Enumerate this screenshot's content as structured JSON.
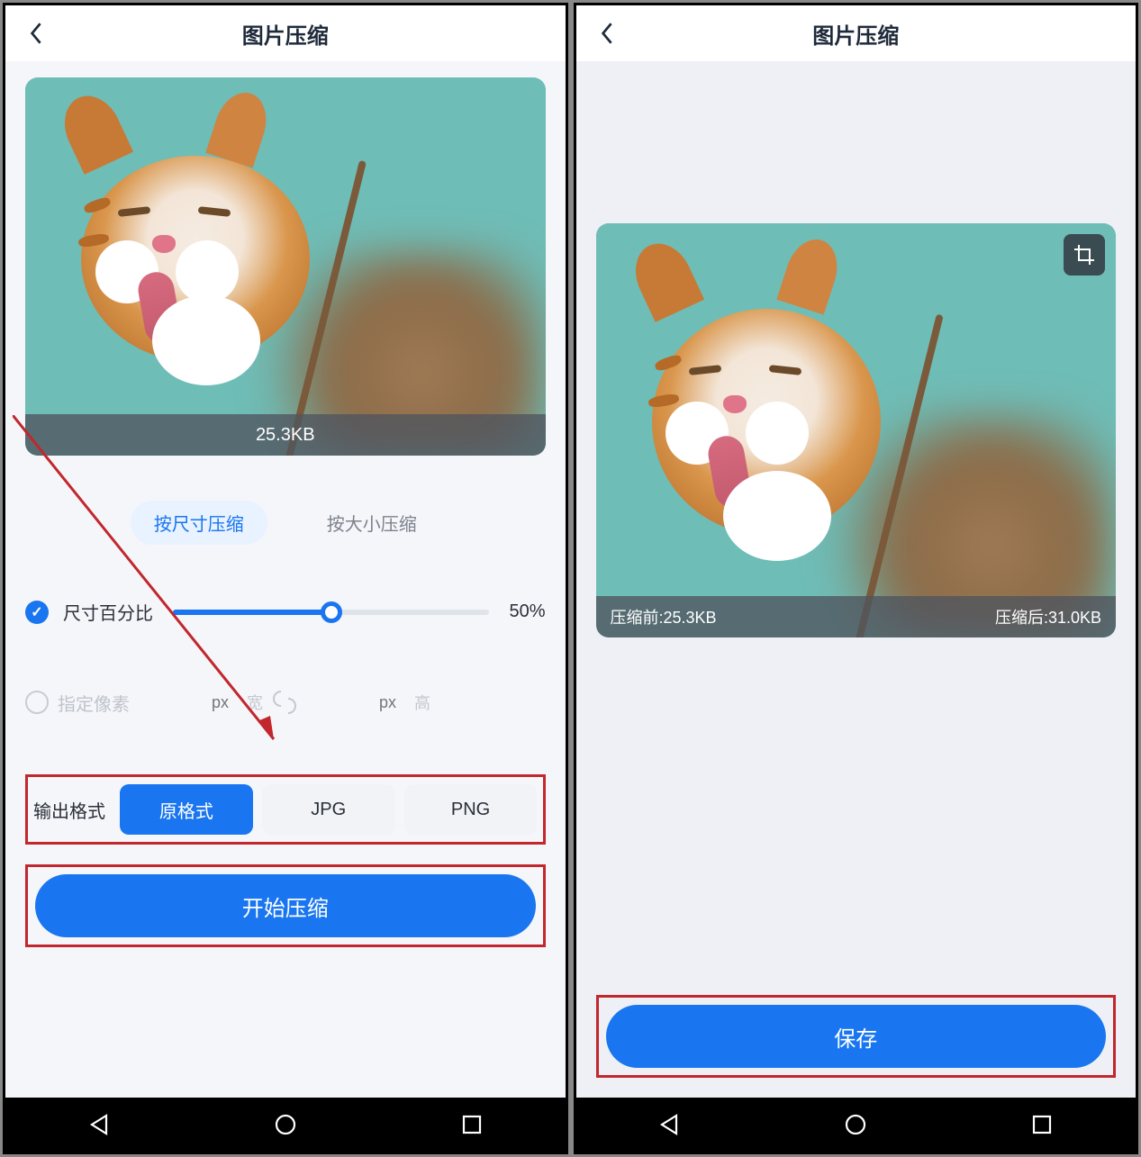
{
  "left": {
    "header": {
      "title": "图片压缩"
    },
    "image": {
      "size_label": "25.3KB"
    },
    "modes": {
      "by_size": "按尺寸压缩",
      "by_filesize": "按大小压缩"
    },
    "slider": {
      "label": "尺寸百分比",
      "value_label": "50%",
      "percent": 50
    },
    "pixels": {
      "label": "指定像素",
      "width_placeholder": "px",
      "width_unit": "宽",
      "height_placeholder": "px",
      "height_unit": "高"
    },
    "format": {
      "label": "输出格式",
      "options": {
        "original": "原格式",
        "jpg": "JPG",
        "png": "PNG"
      }
    },
    "action": "开始压缩"
  },
  "right": {
    "header": {
      "title": "图片压缩"
    },
    "image": {
      "before_label": "压缩前:25.3KB",
      "after_label": "压缩后:31.0KB"
    },
    "action": "保存"
  }
}
